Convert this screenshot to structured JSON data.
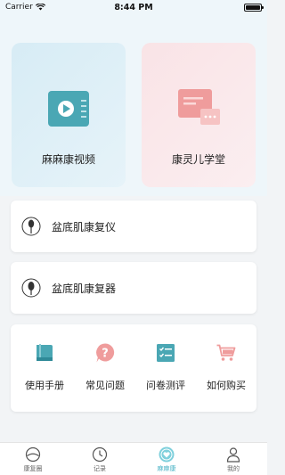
{
  "status_bar": {
    "carrier": "Carrier",
    "time": "8:44 PM"
  },
  "tiles": [
    {
      "label": "麻麻康视频",
      "icon": "video-player-icon"
    },
    {
      "label": "康灵儿学堂",
      "icon": "chat-bubbles-icon"
    }
  ],
  "devices": [
    {
      "label": "盆底肌康复仪",
      "icon": "probe-device-icon"
    },
    {
      "label": "盆底肌康复器",
      "icon": "probe-trainer-icon"
    }
  ],
  "tools": [
    {
      "label": "使用手册",
      "icon": "book-icon"
    },
    {
      "label": "常见问题",
      "icon": "question-icon"
    },
    {
      "label": "问卷测评",
      "icon": "checklist-icon"
    },
    {
      "label": "如何购买",
      "icon": "shopping-cart-icon"
    }
  ],
  "tabbar": [
    {
      "label": "康复圈",
      "icon": "circle-community-icon",
      "active": false
    },
    {
      "label": "记录",
      "icon": "clock-icon",
      "active": false
    },
    {
      "label": "麻麻康",
      "icon": "heart-home-icon",
      "active": true
    },
    {
      "label": "我的",
      "icon": "person-icon",
      "active": false
    }
  ],
  "colors": {
    "accent": "#4bb3c6",
    "teal_icon": "#4aa7b4",
    "pink_icon": "#ef9c9c",
    "page_bg": "#f2f4f6",
    "top_bg": "#eef6fa"
  }
}
